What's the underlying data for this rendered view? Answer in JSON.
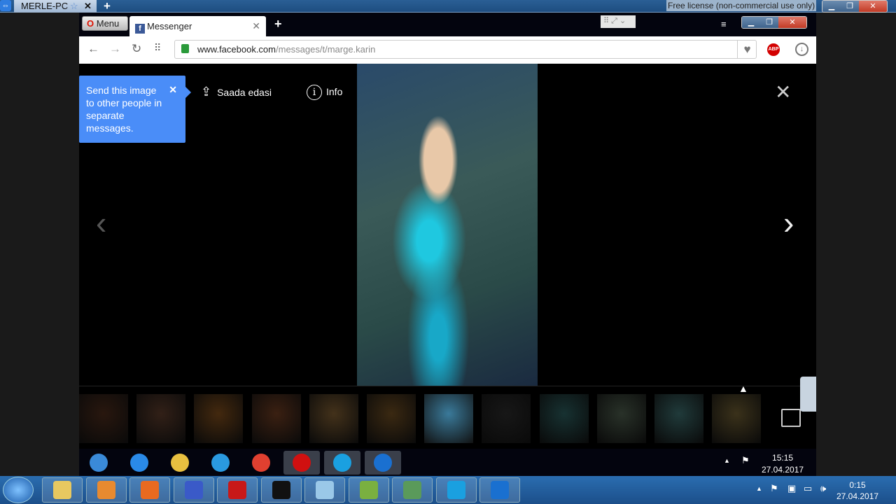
{
  "remote": {
    "tab_label": "MERLE-PC",
    "license": "Free license (non-commercial use only)"
  },
  "browser": {
    "menu_label": "Menu",
    "tab_title": "Messenger",
    "url_domain": "www.facebook.com",
    "url_path": "/messages/t/marge.karin",
    "abp_label": "ABP"
  },
  "viewer": {
    "tooltip": "Send this image to other people in separate messages.",
    "share_label": "Saada edasi",
    "info_label": "Info",
    "thumbnail_count": 12,
    "selected_thumbnail": 7
  },
  "inner_clock": {
    "time": "15:15",
    "date": "27.04.2017"
  },
  "outer_clock": {
    "time": "0:15",
    "date": "27.04.2017"
  },
  "colors": {
    "tooltip": "#4a8df8",
    "taskbar": "#1f5a9a"
  }
}
